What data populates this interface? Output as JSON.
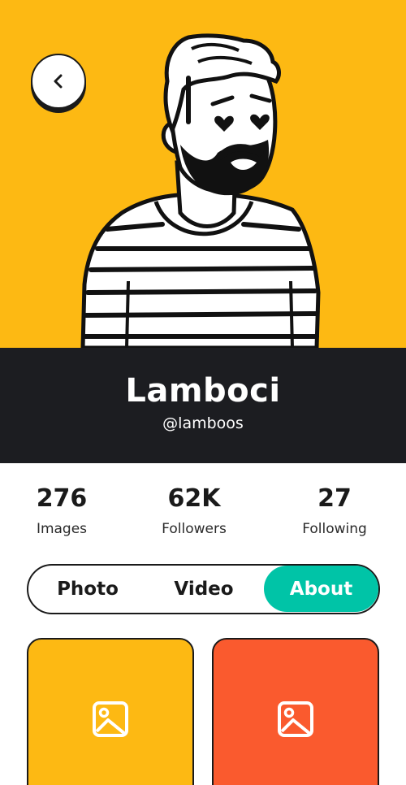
{
  "header": {
    "back_icon": "chevron-left-icon",
    "background_color": "#FDB913"
  },
  "profile": {
    "name": "Lamboci",
    "handle": "@lamboos",
    "band_color": "#1C1D21"
  },
  "stats": [
    {
      "value": "276",
      "label": "Images"
    },
    {
      "value": "62K",
      "label": "Followers"
    },
    {
      "value": "27",
      "label": "Following"
    }
  ],
  "tabs": {
    "items": [
      "Photo",
      "Video",
      "About"
    ],
    "active": "About",
    "active_color": "#00C4A7"
  },
  "gallery": [
    {
      "icon": "image-icon",
      "color": "#FDB913"
    },
    {
      "icon": "image-icon",
      "color": "#FA5A2E"
    }
  ]
}
